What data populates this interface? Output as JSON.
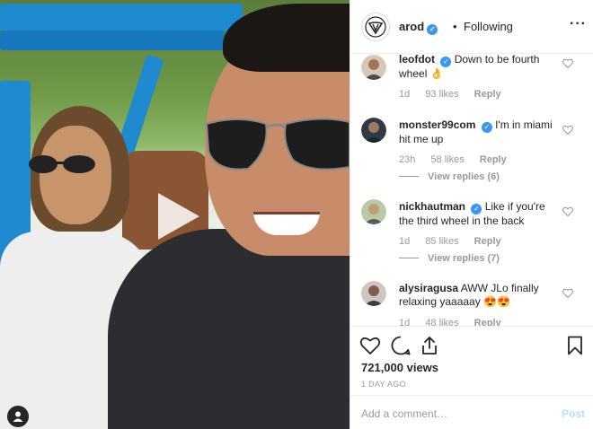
{
  "header": {
    "username": "arod",
    "separator": "•",
    "follow_status": "Following",
    "more": "···"
  },
  "comments": [
    {
      "username": "leofdot",
      "text": "Down to be fourth wheel 👌",
      "verified": true,
      "time": "1d",
      "likes": "93 likes",
      "reply": "Reply",
      "view_replies": null
    },
    {
      "username": "monster99com",
      "text": "I'm in miami hit me up",
      "verified": true,
      "time": "23h",
      "likes": "58 likes",
      "reply": "Reply",
      "view_replies": "View replies (6)"
    },
    {
      "username": "nickhautman",
      "text": "Like if you're the third wheel in the back",
      "verified": true,
      "time": "1d",
      "likes": "85 likes",
      "reply": "Reply",
      "view_replies": "View replies (7)"
    },
    {
      "username": "alysiragusa",
      "text": "AWW JLo finally relaxing yaaaaay 😍😍",
      "verified": false,
      "time": "1d",
      "likes": "48 likes",
      "reply": "Reply",
      "view_replies": null
    }
  ],
  "actions": {
    "icons": [
      "heart-icon",
      "comment-icon",
      "share-icon",
      "bookmark-icon"
    ],
    "views": "721,000 views",
    "time_ago": "1 DAY AGO"
  },
  "add_comment": {
    "placeholder": "Add a comment…",
    "post_label": "Post"
  },
  "colors": {
    "verified": "#3897f0",
    "post_disabled": "#b2dffc",
    "meta_gray": "#999999"
  }
}
